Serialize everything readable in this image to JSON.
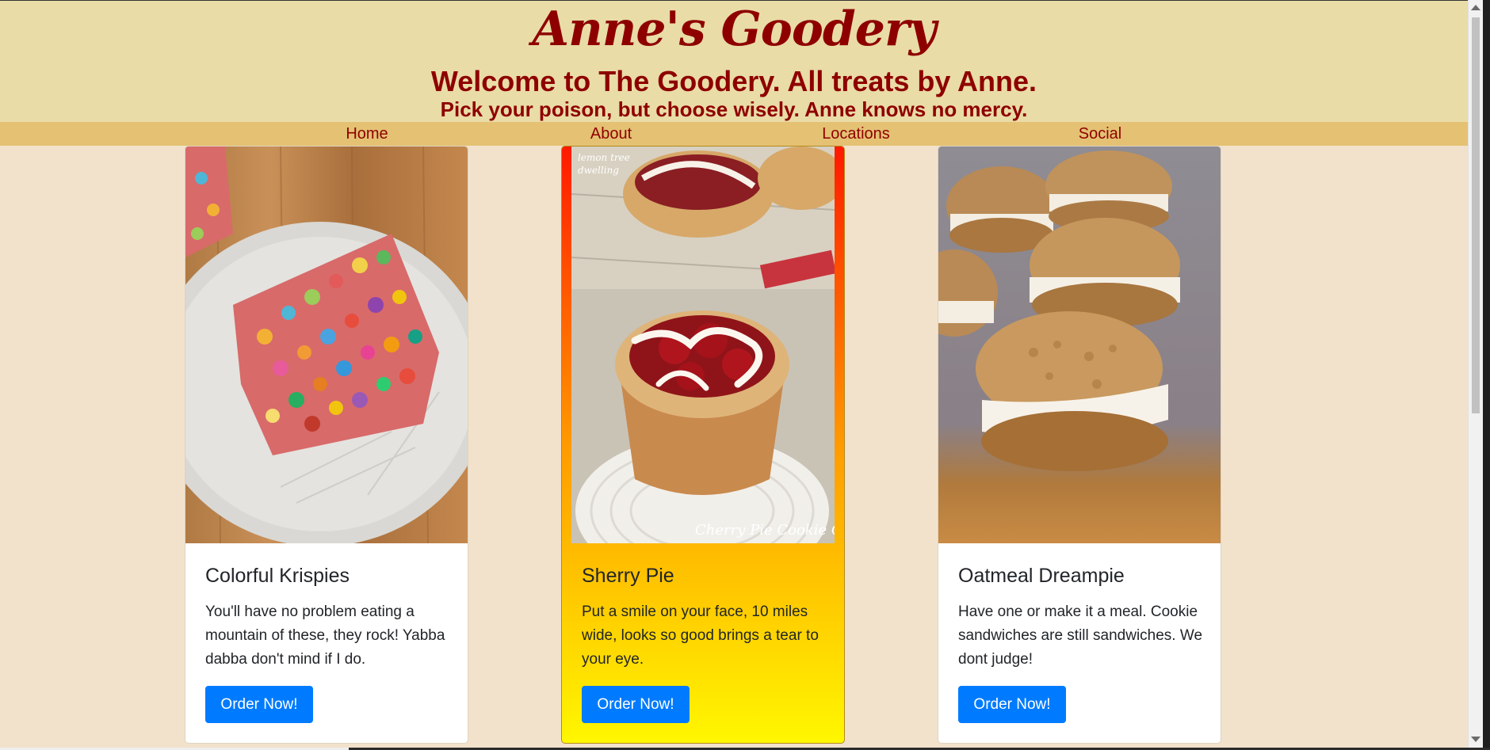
{
  "header": {
    "brand": "Anne's Goodery",
    "welcome": "Welcome to The Goodery. All treats by Anne.",
    "tagline": "Pick your poison, but choose wisely. Anne knows no mercy."
  },
  "nav": {
    "items": [
      {
        "label": "Home"
      },
      {
        "label": "About"
      },
      {
        "label": "Locations"
      },
      {
        "label": "Social"
      }
    ]
  },
  "cards": [
    {
      "title": "Colorful Krispies",
      "text": "You'll have no problem eating a mountain of these, they rock! Yabba dabba don't mind if I do.",
      "button": "Order Now!",
      "image_icon": "cereal-bar-photo"
    },
    {
      "title": "Sherry Pie",
      "text": "Put a smile on your face, 10 miles wide, looks so good brings a tear to your eye.",
      "button": "Order Now!",
      "image_icon": "cherry-pie-cookie-photo",
      "image_caption": "Cherry Pie Cookie Cups",
      "image_watermark": "lemon tree dwelling"
    },
    {
      "title": "Oatmeal Dreampie",
      "text": "Have one or make it a meal. Cookie sandwiches are still sandwiches. We dont judge!",
      "button": "Order Now!",
      "image_icon": "oatmeal-sandwich-cookie-photo"
    }
  ],
  "colors": {
    "brand": "#8e0000",
    "page_bg": "#f2e2cc",
    "header_bg": "#e9dca6",
    "nav_bg": "#e4c173",
    "button": "#007bff"
  }
}
